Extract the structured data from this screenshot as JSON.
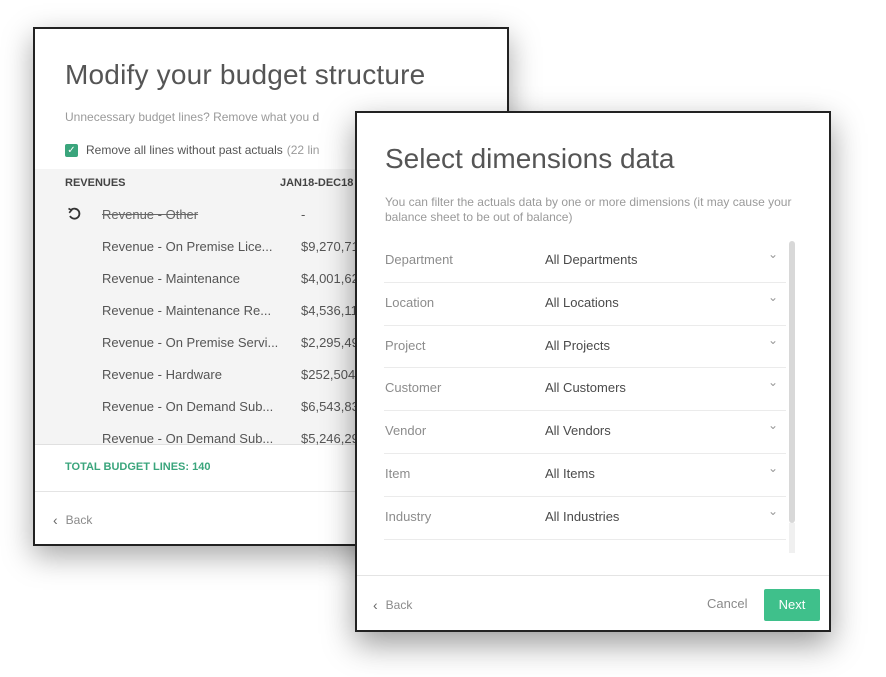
{
  "budget_structure": {
    "title": "Modify your budget structure",
    "subtitle": "Unnecessary budget lines? Remove what you d",
    "checkbox_label": "Remove all lines without past actuals",
    "checkbox_count": "(22 lin",
    "table_header": {
      "col1": "REVENUES",
      "col2": "JAN18-DEC18"
    },
    "rows": [
      {
        "name": "Revenue - Other",
        "value": "-"
      },
      {
        "name": "Revenue - On Premise Lice...",
        "value": "$9,270,71"
      },
      {
        "name": "Revenue - Maintenance",
        "value": "$4,001,62"
      },
      {
        "name": "Revenue - Maintenance Re...",
        "value": "$4,536,11"
      },
      {
        "name": "Revenue - On Premise Servi...",
        "value": "$2,295,49"
      },
      {
        "name": "Revenue - Hardware",
        "value": "$252,504"
      },
      {
        "name": "Revenue - On Demand Sub...",
        "value": "$6,543,83"
      },
      {
        "name": "Revenue - On Demand Sub...",
        "value": "$5,246,29"
      }
    ],
    "total": "TOTAL BUDGET LINES: 140",
    "back_label": "Back"
  },
  "dimensions_dialog": {
    "title": "Select dimensions data",
    "description": "You can filter the actuals data by one or more dimensions (it may cause your balance sheet to be out of balance)",
    "dimensions": [
      {
        "label": "Department",
        "value": "All Departments"
      },
      {
        "label": "Location",
        "value": "All Locations"
      },
      {
        "label": "Project",
        "value": "All Projects"
      },
      {
        "label": "Customer",
        "value": "All Customers"
      },
      {
        "label": "Vendor",
        "value": "All Vendors"
      },
      {
        "label": "Item",
        "value": "All Items"
      },
      {
        "label": "Industry",
        "value": "All Industries"
      }
    ],
    "back_label": "Back",
    "cancel_label": "Cancel",
    "next_label": "Next"
  },
  "colors": {
    "accent": "#3fc08b",
    "total_text": "#3aa57c"
  },
  "icons": {
    "checkbox": "check-icon",
    "undo": "undo-icon",
    "back": "chevron-left-icon",
    "dropdown": "chevron-down-icon"
  }
}
